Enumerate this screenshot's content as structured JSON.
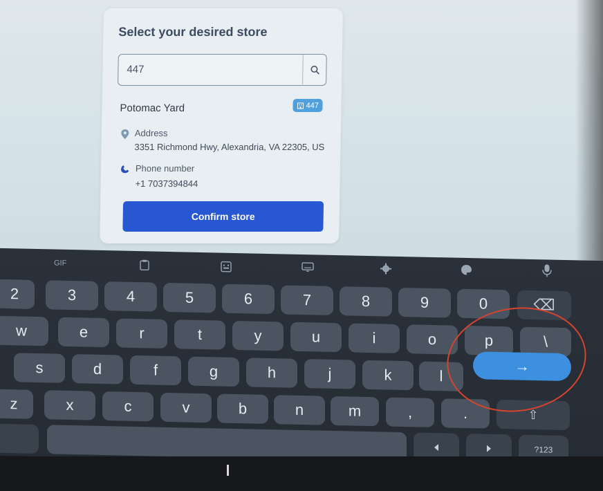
{
  "store_selector": {
    "title": "Select your desired store",
    "search": {
      "value": "447",
      "icon": "search-icon"
    },
    "result": {
      "name": "Potomac Yard",
      "badge": "447",
      "address_label": "Address",
      "address_value": "3351 Richmond Hwy, Alexandria, VA 22305, US",
      "phone_label": "Phone number",
      "phone_value": "+1 7037394844"
    },
    "confirm_label": "Confirm store",
    "colors": {
      "primary": "#2857d3",
      "badge": "#4fa0dc"
    }
  },
  "keyboard": {
    "toolbar": {
      "gif_label": "GIF"
    },
    "row_numbers": [
      "2",
      "3",
      "4",
      "5",
      "6",
      "7",
      "8",
      "9",
      "0"
    ],
    "row_top": [
      "w",
      "e",
      "r",
      "t",
      "y",
      "u",
      "i",
      "o",
      "p",
      "\\"
    ],
    "row_mid": [
      "s",
      "d",
      "f",
      "g",
      "h",
      "j",
      "k",
      "l"
    ],
    "row_bottom": [
      "z",
      "x",
      "c",
      "v",
      "b",
      "n",
      "m",
      ",",
      "."
    ],
    "symbols_label": "?123",
    "enter_glyph": "→",
    "shift_glyph": "⇧",
    "backspace_glyph": "⌫"
  }
}
